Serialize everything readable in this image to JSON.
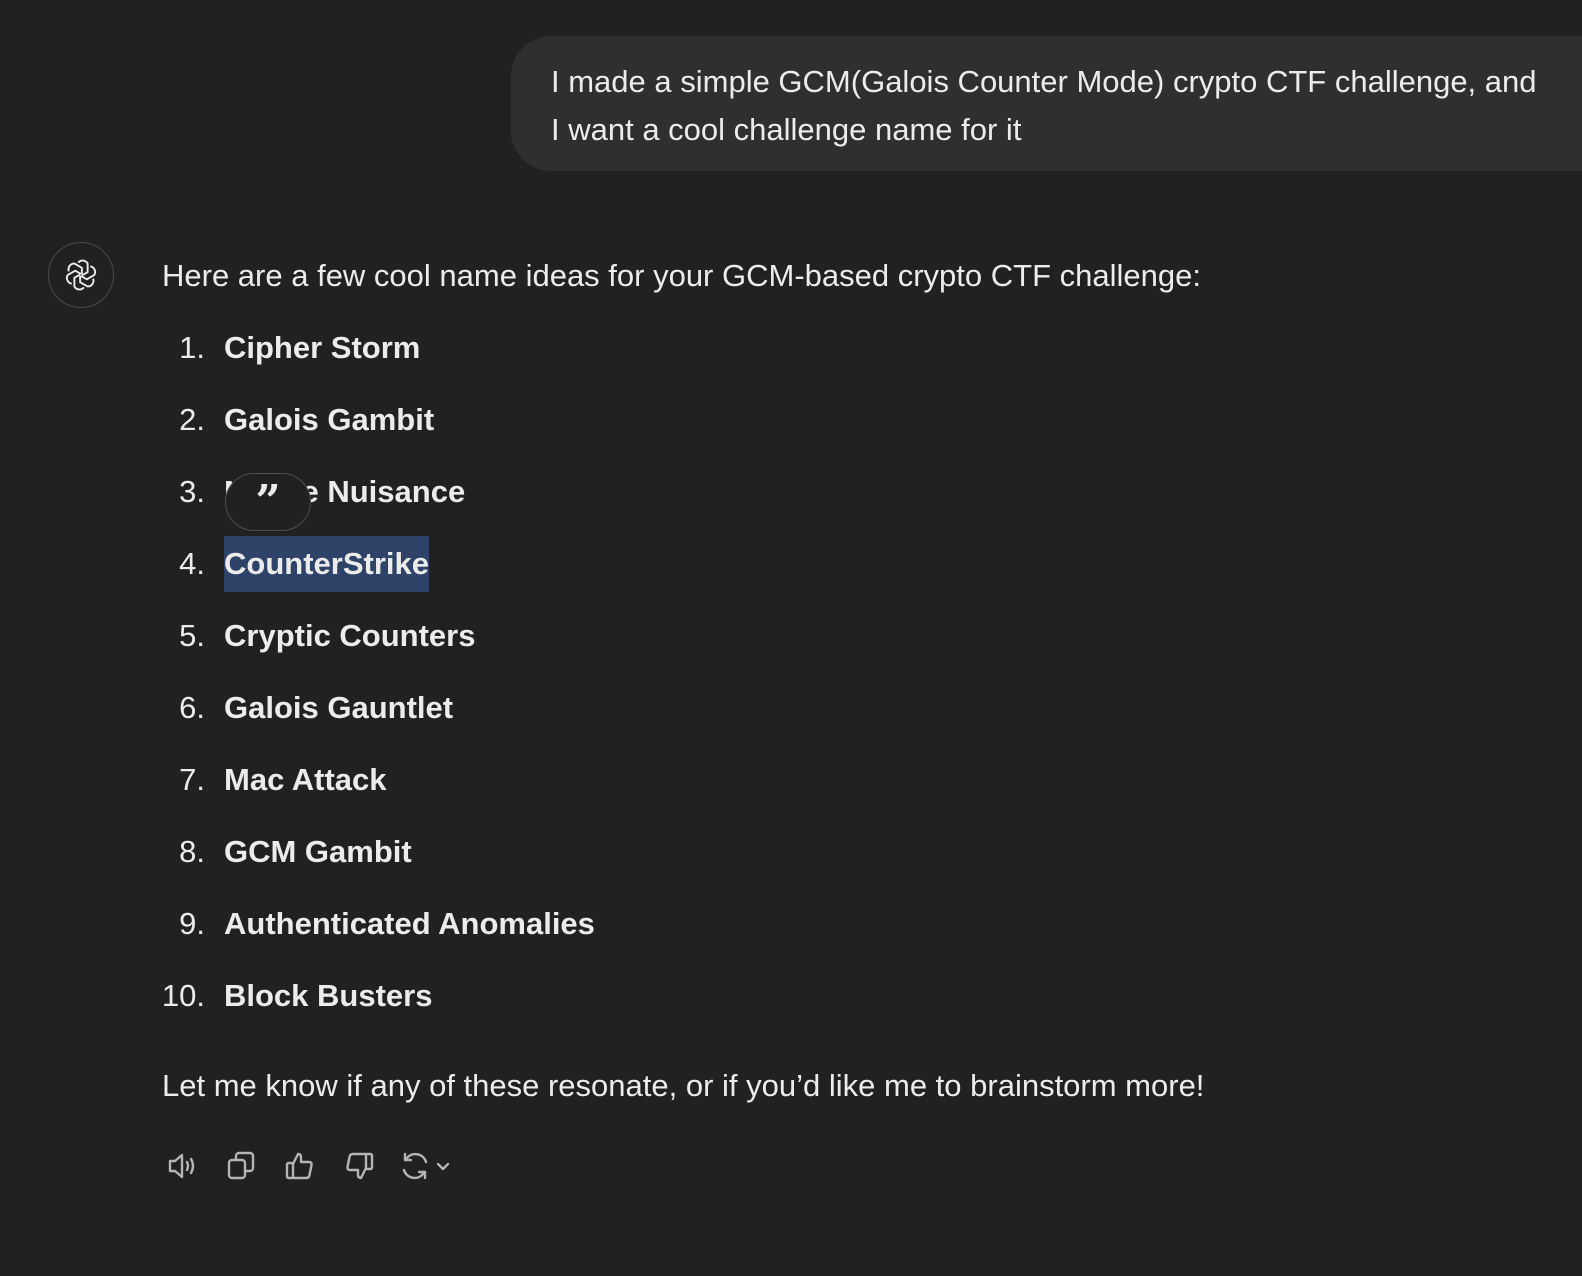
{
  "user_message": {
    "text": "I made a simple GCM(Galois Counter Mode) crypto CTF challenge, and I want a cool challenge name for it"
  },
  "assistant": {
    "avatar_icon": "openai-logo-icon",
    "intro": "Here are a few cool name ideas for your GCM-based crypto CTF challenge:",
    "items": [
      {
        "num": "1.",
        "name": "Cipher Storm"
      },
      {
        "num": "2.",
        "name": "Galois Gambit"
      },
      {
        "num": "3.",
        "name": "Nonce Nuisance"
      },
      {
        "num": "4.",
        "name": "CounterStrike"
      },
      {
        "num": "5.",
        "name": "Cryptic Counters"
      },
      {
        "num": "6.",
        "name": "Galois Gauntlet"
      },
      {
        "num": "7.",
        "name": "Mac Attack"
      },
      {
        "num": "8.",
        "name": "GCM Gambit"
      },
      {
        "num": "9.",
        "name": "Authenticated Anomalies"
      },
      {
        "num": "10.",
        "name": "Block Busters"
      }
    ],
    "selected_item": "CounterStrike",
    "outro": "Let me know if any of these resonate, or if you’d like me to brainstorm more!"
  },
  "quote_popup": {
    "icon": "quote-icon",
    "glyph": "”"
  },
  "actions": [
    {
      "name": "read-aloud-button",
      "icon": "speaker-icon"
    },
    {
      "name": "copy-button",
      "icon": "copy-icon"
    },
    {
      "name": "good-response-button",
      "icon": "thumbs-up-icon"
    },
    {
      "name": "bad-response-button",
      "icon": "thumbs-down-icon"
    },
    {
      "name": "regenerate-button",
      "icon": "refresh-icon"
    }
  ],
  "colors": {
    "background": "#212121",
    "user_bubble": "#2f2f2f",
    "text": "#ececec",
    "selection": "#2f4268",
    "icon": "#b4b4b4"
  }
}
